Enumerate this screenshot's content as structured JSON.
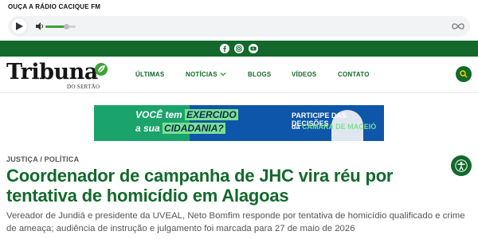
{
  "radio": {
    "title": "OUÇA A RÁDIO CACIQUE FM",
    "volume_percent": 70
  },
  "social": {
    "icons": [
      "facebook-icon",
      "instagram-icon",
      "youtube-icon"
    ]
  },
  "logo": {
    "name": "Tribuna",
    "subtitle": "DO SERTÃO"
  },
  "nav": {
    "items": [
      {
        "label": "ÚLTIMAS"
      },
      {
        "label": "NOTÍCIAS"
      },
      {
        "label": "BLOGS"
      },
      {
        "label": "VÍDEOS"
      },
      {
        "label": "CONTATO"
      }
    ]
  },
  "banner": {
    "line1_a": "VOCÊ tem",
    "line1_b": "EXERCIDO",
    "line2_a": "a sua",
    "line2_b": "CIDADANIA?",
    "right1": "PARTICIPE DAS DECISÕES",
    "right2_a": "da",
    "right2_b": "CÂMARA DE MACEIÓ"
  },
  "article": {
    "kicker": "JUSTIÇA / POLÍTICA",
    "headline": "Coordenador de campanha de JHC vira réu por tentativa de homicídio em Alagoas",
    "summary": "Vereador de Jundiá e presidente da UVEAL, Neto Bomfim responde por tentativa de homicídio qualificado e crime de ameaça; audiência de instrução e julgamento foi marcada para 27 de maio de 2026"
  },
  "colors": {
    "brand_green": "#12692b",
    "accent_green": "#3aa335"
  }
}
